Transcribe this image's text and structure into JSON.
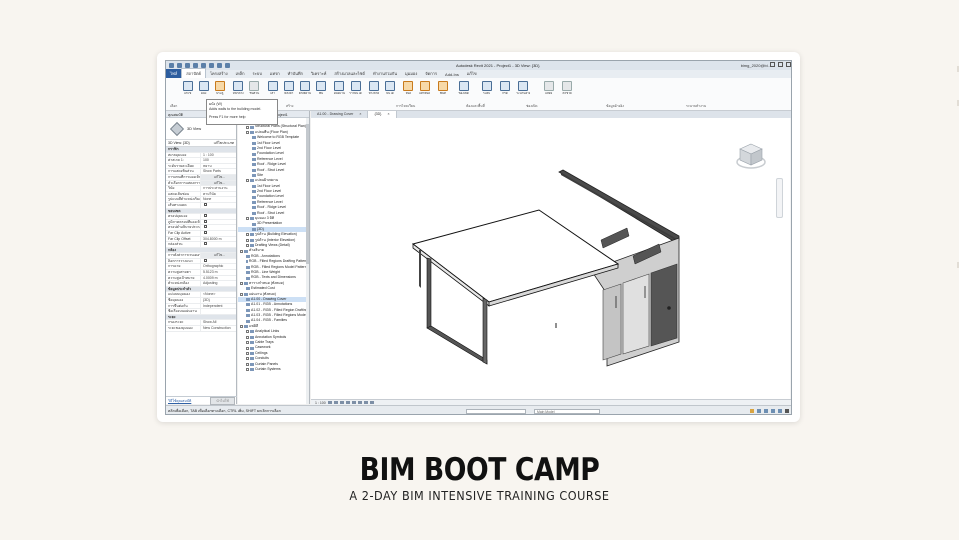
{
  "titlebar": {
    "title": "Autodesk Revit 2021 - Project1 - 3D View: {3D}",
    "user": "bimg_2020@bi..."
  },
  "ribbon": {
    "tabs": [
      "ไฟล์",
      "สถาปัตย์",
      "โครงสร้าง",
      "เหล็ก",
      "ระบบ",
      "แทรก",
      "ทำบันทึก",
      "วิเคราะห์",
      "สร้างมวลและไซต์",
      "ทำงานร่วมกัน",
      "มุมมอง",
      "จัดการ",
      "Add-Ins",
      "แก้ไข"
    ],
    "tools": [
      "แก้ไข",
      "ผนัง",
      "ประตู",
      "หน้าต่าง",
      "ชิ้นส่วน",
      "เสา",
      "หลังคา",
      "ฝ้าเพดาน",
      "พื้น",
      "ผนังม่าน",
      "ราวบันได",
      "ทางลาด",
      "บันได",
      "ห้อง",
      "แท็กห้อง",
      "พื้นที่",
      "ช่องเปิด",
      "ระดับ",
      "กริด",
      "ระนาบอ้างอิง",
      "แสดง",
      "ตัวช่วย"
    ],
    "panels": [
      "เลือก",
      "สร้าง",
      "การไหลเวียน",
      "ห้องและพื้นที่",
      "ช่องเปิด",
      "ข้อมูลอ้างอิง",
      "ระนาบทำงาน"
    ],
    "tooltip": {
      "title": "ผนัง (W)",
      "desc": "Adds walls to the building model.",
      "help": "Press F1 for more help"
    }
  },
  "properties": {
    "header": "คุณสมบัติ",
    "type_name": "3D View",
    "selector": "3D View: {3D}",
    "edit_type": "แก้ไขประเภท",
    "rows": [
      {
        "k": "กราฟิก",
        "v": "",
        "cat": true
      },
      {
        "k": "สเกลมุมมอง",
        "v": "1 : 100"
      },
      {
        "k": "ค่าสเกล 1:",
        "v": "100"
      },
      {
        "k": "ระดับรายละเอียด",
        "v": "หยาบ"
      },
      {
        "k": "การแสดงชิ้นส่วน",
        "v": "Show Parts"
      },
      {
        "k": "การแทนที่การมองเห็น",
        "v": "แก้ไข...",
        "btn": true
      },
      {
        "k": "ตัวเลือกการแสดงกราฟิก",
        "v": "แก้ไข...",
        "btn": true
      },
      {
        "k": "วินัย",
        "v": "การประสานงาน"
      },
      {
        "k": "แสดงเส้นซ่อน",
        "v": "ตามวินัย"
      },
      {
        "k": "รูปแบบสีตำแหน่งเริ่มต้น",
        "v": "None"
      },
      {
        "k": "เส้นทางแดด",
        "v": "",
        "chk": true
      },
      {
        "k": "ขอบเขต",
        "v": "",
        "cat": true
      },
      {
        "k": "ครอปมุมมอง",
        "v": "",
        "chk": true
      },
      {
        "k": "ภูมิภาคครอปที่มองเห็น",
        "v": "",
        "chk": true
      },
      {
        "k": "ครอปคำอธิบายประกอบ",
        "v": "",
        "chk": true
      },
      {
        "k": "Far Clip Active",
        "v": "",
        "chk": true
      },
      {
        "k": "Far Clip Offset",
        "v": "304.8000 m"
      },
      {
        "k": "กล่องส่วน",
        "v": "",
        "chk": true
      },
      {
        "k": "กล้อง",
        "v": "",
        "cat": true
      },
      {
        "k": "การตั้งค่าการเรนเดอร์",
        "v": "แก้ไข...",
        "btn": true
      },
      {
        "k": "ล็อกการวางแนว",
        "v": "",
        "chk": true
      },
      {
        "k": "การฉาย",
        "v": "Orthographic"
      },
      {
        "k": "ความสูงสายตา",
        "v": "5.5123 m"
      },
      {
        "k": "ความสูงเป้าหมาย",
        "v": "4.0009 m"
      },
      {
        "k": "ตำแหน่งกล้อง",
        "v": "Adjusting"
      },
      {
        "k": "ข้อมูลประจำตัว",
        "v": "",
        "cat": true
      },
      {
        "k": "แม่แบบมุมมอง",
        "v": "<None>"
      },
      {
        "k": "ชื่อมุมมอง",
        "v": "{3D}"
      },
      {
        "k": "การขึ้นต่อกัน",
        "v": "Independent"
      },
      {
        "k": "ชื่อเรื่องบนแผ่นงาน",
        "v": ""
      },
      {
        "k": "ระยะ",
        "v": "",
        "cat": true
      },
      {
        "k": "กรองระยะ",
        "v": "Show All"
      },
      {
        "k": "ระยะของมุมมอง",
        "v": "New Construction"
      }
    ],
    "help_link": "วิธีใช้คุณสมบัติ",
    "apply": "นำไปใช้"
  },
  "browser": {
    "header": "เบราว์เซอร์โปรเจกต์ - Project1",
    "rows": [
      {
        "t": "มุมมอง (ทั้งหมด)",
        "d": 0,
        "g": true
      },
      {
        "t": "Structural Plans (Structural Plan)",
        "d": 1,
        "g": true
      },
      {
        "t": "แปลนพื้น (Floor Plan)",
        "d": 1,
        "g": true
      },
      {
        "t": "Welcome to RGB Template",
        "d": 2
      },
      {
        "t": "1st Floor Level",
        "d": 2
      },
      {
        "t": "2nd Floor Level",
        "d": 2
      },
      {
        "t": "Foundation Level",
        "d": 2
      },
      {
        "t": "Reference Level",
        "d": 2
      },
      {
        "t": "Roof - Ridge Level",
        "d": 2
      },
      {
        "t": "Roof - Strut Level",
        "d": 2
      },
      {
        "t": "Site",
        "d": 2
      },
      {
        "t": "แปลนฝ้าเพดาน",
        "d": 1,
        "g": true
      },
      {
        "t": "1st Floor Level",
        "d": 2
      },
      {
        "t": "2nd Floor Level",
        "d": 2
      },
      {
        "t": "Foundation Level",
        "d": 2
      },
      {
        "t": "Reference Level",
        "d": 2
      },
      {
        "t": "Roof - Ridge Level",
        "d": 2
      },
      {
        "t": "Roof - Strut Level",
        "d": 2
      },
      {
        "t": "มุมมอง 3 มิติ",
        "d": 1,
        "g": true
      },
      {
        "t": "3D Presentation",
        "d": 2
      },
      {
        "t": "{3D}",
        "d": 2,
        "sel": true
      },
      {
        "t": "รูปด้าน (Building Elevation)",
        "d": 1,
        "g": true
      },
      {
        "t": "รูปด้าน (Interior Elevation)",
        "d": 1,
        "g": true
      },
      {
        "t": "Drafting Views (Detail)",
        "d": 1,
        "g": true
      },
      {
        "t": "คำอธิบาย",
        "d": 0,
        "g": true
      },
      {
        "t": "RGB - Annotations",
        "d": 1
      },
      {
        "t": "RGB - Filled Regions Drafting Patterns",
        "d": 1
      },
      {
        "t": "RGB - Filled Regions Model Patterns",
        "d": 1
      },
      {
        "t": "RGB - Line Weight",
        "d": 1
      },
      {
        "t": "RGB - Texts and Dimensions",
        "d": 1
      },
      {
        "t": "ตารางกำหนด (ทั้งหมด)",
        "d": 0,
        "g": true
      },
      {
        "t": "Estimated Cost",
        "d": 1
      },
      {
        "t": "แผ่นงาน (ทั้งหมด)",
        "d": 0,
        "g": true
      },
      {
        "t": "A1.00 - Drawing Cover",
        "d": 1,
        "sel": true
      },
      {
        "t": "A1.01 - RGB - Annotations",
        "d": 1
      },
      {
        "t": "A1.02 - RGB - Filled Region Drafting",
        "d": 1
      },
      {
        "t": "A1.03 - RGB - Filled Regions Model",
        "d": 1
      },
      {
        "t": "A1.04 - RGB - Families",
        "d": 1
      },
      {
        "t": "แฟมิลี",
        "d": 0,
        "g": true
      },
      {
        "t": "Analytical Links",
        "d": 1,
        "g": true
      },
      {
        "t": "Annotation Symbols",
        "d": 1,
        "g": true
      },
      {
        "t": "Cable Trays",
        "d": 1,
        "g": true
      },
      {
        "t": "Casework",
        "d": 1,
        "g": true
      },
      {
        "t": "Ceilings",
        "d": 1,
        "g": true
      },
      {
        "t": "Conduits",
        "d": 1,
        "g": true
      },
      {
        "t": "Curtain Panels",
        "d": 1,
        "g": true
      },
      {
        "t": "Curtain Systems",
        "d": 1,
        "g": true
      }
    ]
  },
  "views": {
    "tabs": [
      {
        "label": "A1.00 - Drawing Cover",
        "active": false
      },
      {
        "label": "{3D}",
        "active": true
      }
    ],
    "scale": "1 : 100"
  },
  "statusbar": {
    "text": "คลิกเพื่อเลือก, TAB เพื่อเลือกทางเลือก, CTRL เพิ่ม, SHIFT ยกเลิกการเลือก",
    "model": "Main Model"
  },
  "headline": {
    "title": "BIM BOOT CAMP",
    "subtitle": "A 2-DAY BIM INTENSIVE TRAINING COURSE"
  }
}
